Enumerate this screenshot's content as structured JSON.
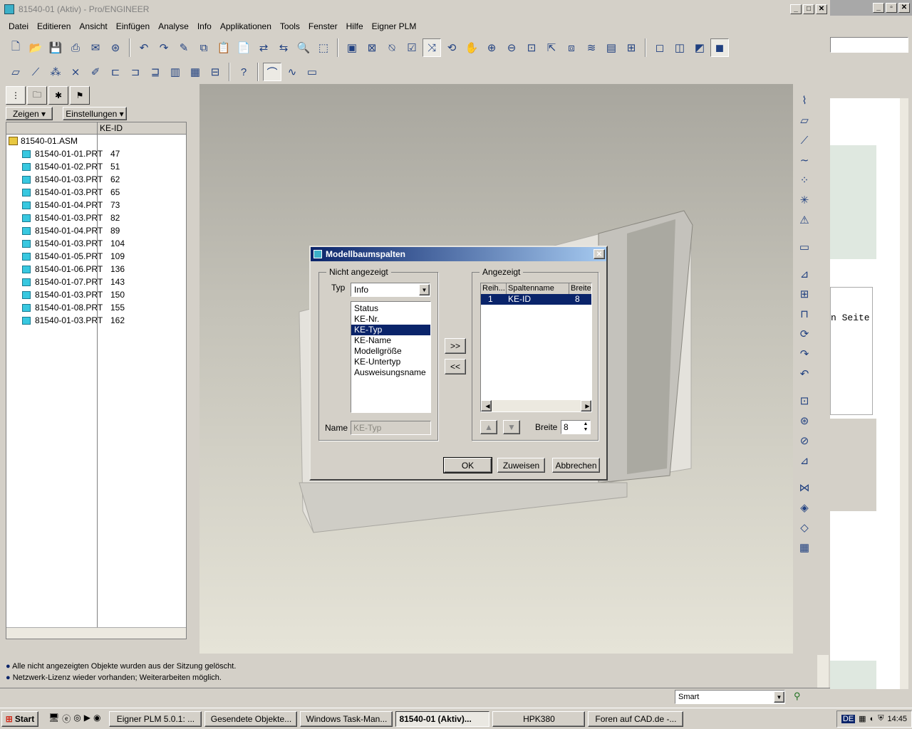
{
  "window": {
    "title": "81540-01 (Aktiv) - Pro/ENGINEER",
    "min": "_",
    "max": "□",
    "close": "✕"
  },
  "menu": [
    "Datei",
    "Editieren",
    "Ansicht",
    "Einfügen",
    "Analyse",
    "Info",
    "Applikationen",
    "Tools",
    "Fenster",
    "Hilfe",
    "Eigner PLM"
  ],
  "panel": {
    "zeigen": "Zeigen ▾",
    "einstellungen": "Einstellungen ▾",
    "col_header": "KE-ID",
    "root": "81540-01.ASM",
    "rows": [
      [
        "81540-01-01.PRT",
        "47"
      ],
      [
        "81540-01-02.PRT",
        "51"
      ],
      [
        "81540-01-03.PRT",
        "62"
      ],
      [
        "81540-01-03.PRT",
        "65"
      ],
      [
        "81540-01-04.PRT",
        "73"
      ],
      [
        "81540-01-03.PRT",
        "82"
      ],
      [
        "81540-01-04.PRT",
        "89"
      ],
      [
        "81540-01-03.PRT",
        "104"
      ],
      [
        "81540-01-05.PRT",
        "109"
      ],
      [
        "81540-01-06.PRT",
        "136"
      ],
      [
        "81540-01-07.PRT",
        "143"
      ],
      [
        "81540-01-03.PRT",
        "150"
      ],
      [
        "81540-01-08.PRT",
        "155"
      ],
      [
        "81540-01-03.PRT",
        "162"
      ]
    ]
  },
  "dialog": {
    "title": "Modellbaumspalten",
    "close": "✕",
    "left_group": "Nicht angezeigt",
    "typ_label": "Typ",
    "typ_value": "Info",
    "items": [
      "Status",
      "KE-Nr.",
      "KE-Typ",
      "KE-Name",
      "Modellgröße",
      "KE-Untertyp",
      "Ausweisungsname"
    ],
    "selected_index": 2,
    "name_label": "Name",
    "name_value": "KE-Typ",
    "add": ">>",
    "remove": "<<",
    "right_group": "Angezeigt",
    "cols": [
      "Reih...",
      "Spaltenname",
      "Breite"
    ],
    "row": [
      "1",
      "KE-ID",
      "8"
    ],
    "breite_label": "Breite",
    "breite_value": "8",
    "ok": "OK",
    "apply": "Zuweisen",
    "cancel": "Abbrechen"
  },
  "messages": [
    "Alle nicht angezeigten Objekte wurden aus der Sitzung gelöscht.",
    "Netzwerk-Lizenz wieder vorhanden; Weiterarbeiten möglich."
  ],
  "filter": "Smart",
  "bg_text": "n Seite",
  "taskbar": {
    "start": "Start",
    "tasks": [
      "Eigner PLM 5.0.1: ...",
      "Gesendete Objekte...",
      "Windows Task-Man...",
      "81540-01 (Aktiv)...",
      "HPK380",
      "Foren auf CAD.de -..."
    ],
    "lang": "DE",
    "clock": "14:45"
  }
}
